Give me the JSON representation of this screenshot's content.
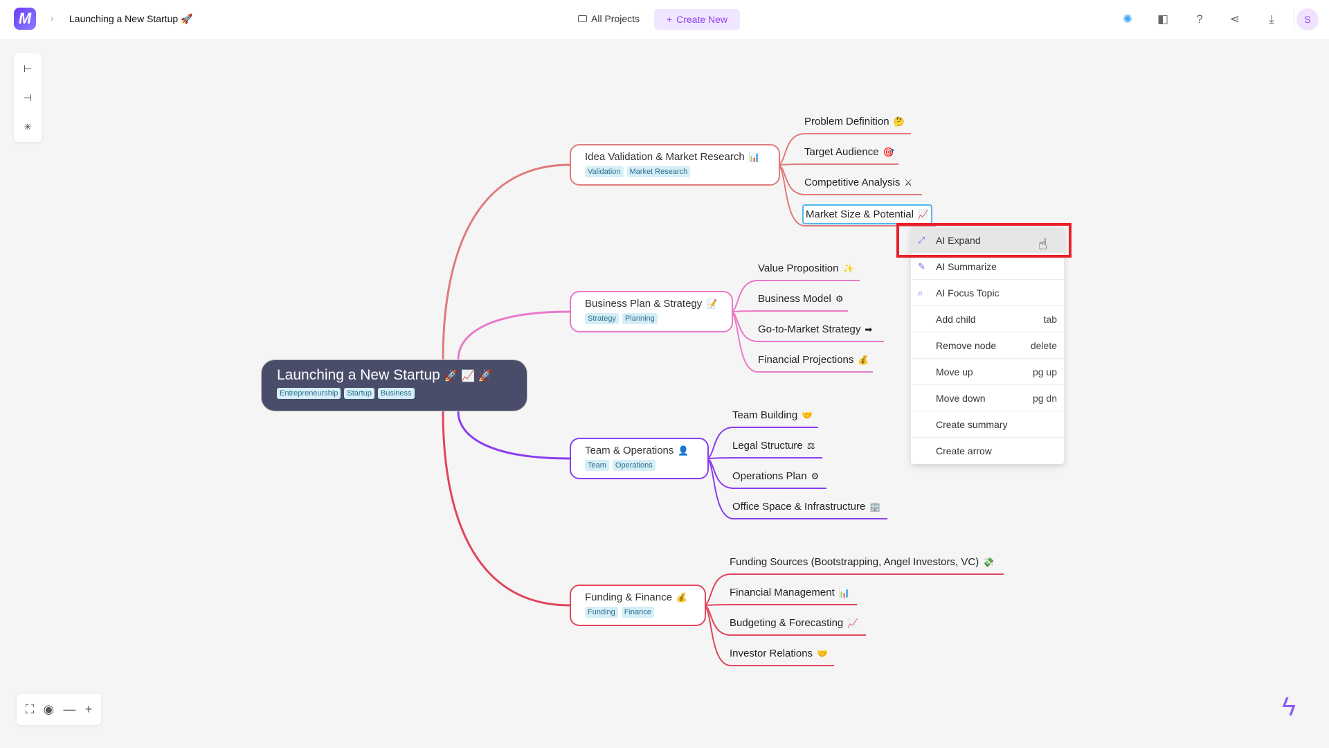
{
  "header": {
    "logo_text": "M",
    "breadcrumb_sep": "›",
    "title": "Launching a New Startup 🚀",
    "all_projects": "All Projects",
    "create_new": "Create New",
    "create_icon": "+",
    "icons": [
      "sparkle-icon",
      "palette-icon",
      "help-icon",
      "share-icon",
      "download-icon"
    ],
    "icon_glyphs": [
      "✺",
      "◧",
      "?",
      "⋖",
      "⤓"
    ],
    "avatar": "S"
  },
  "left_toolbar": {
    "icons": [
      "layout-right-icon",
      "layout-left-icon",
      "layout-radial-icon"
    ],
    "glyphs": [
      "⊢",
      "⊣",
      "✳"
    ]
  },
  "bottom_controls": {
    "icons": [
      "fit-screen-icon",
      "locate-icon",
      "zoom-out-icon",
      "zoom-in-icon"
    ],
    "glyphs": [
      "⛶",
      "◉",
      "—",
      "+"
    ]
  },
  "colors": {
    "accent": "#8b3df0",
    "root_bg": "#4a4d6a",
    "selected_border": "#4db8f0",
    "highlight": "#e8202a"
  },
  "mindmap": {
    "root": {
      "title": "Launching a New Startup",
      "emoji": "🚀 📈 🚀",
      "tags": [
        "Entrepreneurship",
        "Startup",
        "Business"
      ]
    },
    "branches": [
      {
        "title": "Idea Validation & Market Research",
        "emoji": "📊",
        "tags": [
          "Validation",
          "Market Research"
        ],
        "color": "#e07a7a",
        "children": [
          {
            "label": "Problem Definition",
            "emoji": "🤔"
          },
          {
            "label": "Target Audience",
            "emoji": "🎯"
          },
          {
            "label": "Competitive Analysis",
            "emoji": "⚔"
          },
          {
            "label": "Market Size & Potential",
            "emoji": "📈",
            "selected": true
          }
        ]
      },
      {
        "title": "Business Plan & Strategy",
        "emoji": "📝",
        "tags": [
          "Strategy",
          "Planning"
        ],
        "color": "#e879c9",
        "children": [
          {
            "label": "Value Proposition",
            "emoji": "✨"
          },
          {
            "label": "Business Model",
            "emoji": "⚙"
          },
          {
            "label": "Go-to-Market Strategy",
            "emoji": "➡"
          },
          {
            "label": "Financial Projections",
            "emoji": "💰"
          }
        ]
      },
      {
        "title": "Team & Operations",
        "emoji": "👤",
        "tags": [
          "Team",
          "Operations"
        ],
        "color": "#8b3df0",
        "children": [
          {
            "label": "Team Building",
            "emoji": "🤝"
          },
          {
            "label": "Legal Structure",
            "emoji": "⚖"
          },
          {
            "label": "Operations Plan",
            "emoji": "⚙"
          },
          {
            "label": "Office Space & Infrastructure",
            "emoji": "🏢"
          }
        ]
      },
      {
        "title": "Funding & Finance",
        "emoji": "💰",
        "tags": [
          "Funding",
          "Finance"
        ],
        "color": "#e0455a",
        "children": [
          {
            "label": "Funding Sources (Bootstrapping, Angel Investors, VC)",
            "emoji": "💸"
          },
          {
            "label": "Financial Management",
            "emoji": "📊"
          },
          {
            "label": "Budgeting & Forecasting",
            "emoji": "📈"
          },
          {
            "label": "Investor Relations",
            "emoji": "🤝"
          }
        ]
      }
    ]
  },
  "context_menu": {
    "items": [
      {
        "label": "AI Expand",
        "icon": "expand-icon",
        "glyph": "⤢",
        "shortcut": "",
        "hovered": true
      },
      {
        "label": "AI Summarize",
        "icon": "edit-icon",
        "glyph": "✎",
        "shortcut": ""
      },
      {
        "label": "AI Focus Topic",
        "icon": "search-icon",
        "glyph": "⌕",
        "shortcut": ""
      },
      {
        "label": "Add child",
        "shortcut": "tab"
      },
      {
        "label": "Remove node",
        "shortcut": "delete"
      },
      {
        "label": "Move up",
        "shortcut": "pg up"
      },
      {
        "label": "Move down",
        "shortcut": "pg dn"
      },
      {
        "label": "Create summary",
        "shortcut": ""
      },
      {
        "label": "Create arrow",
        "shortcut": ""
      }
    ]
  }
}
